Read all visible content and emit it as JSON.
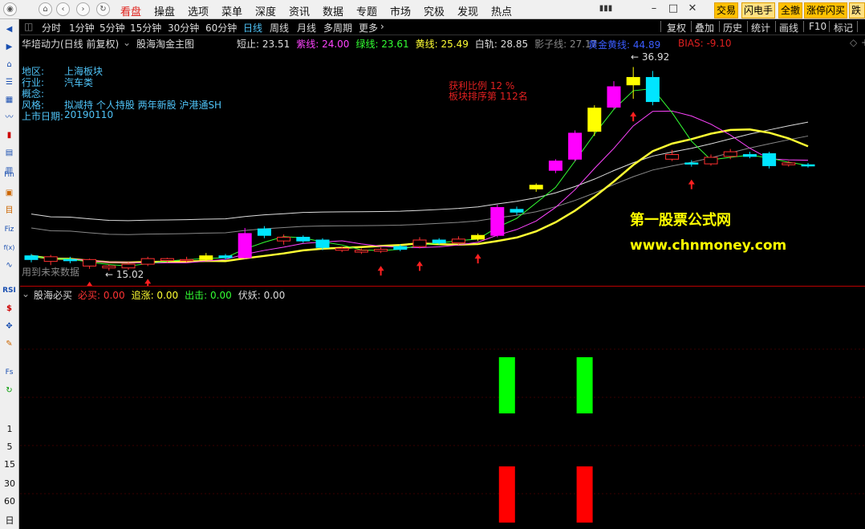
{
  "menubar": {
    "items": [
      "看盘",
      "操盘",
      "选项",
      "菜单",
      "深度",
      "资讯",
      "数据",
      "专题",
      "市场",
      "究极",
      "发现",
      "热点"
    ],
    "active_index": 0,
    "trade_buttons": [
      "交易",
      "闪电手",
      "全撤",
      "涨停闪买",
      "跌"
    ]
  },
  "lefttool": {
    "icons": [
      "back-arrow-icon",
      "forward-arrow-icon",
      "home-icon",
      "list-icon",
      "grid-icon",
      "line-chart-icon",
      "candle-icon",
      "table-icon",
      "stack-icon",
      "fin-icon",
      "f10-icon",
      "news-icon",
      "formula-icon",
      "fx-icon",
      "wave-icon",
      "rsi-icon",
      "dollar-icon",
      "move-icon",
      "pencil-icon",
      "fs-icon",
      "refresh-icon"
    ],
    "labels": {
      "fin": "Fin",
      "fiz": "Fiz",
      "fx": "f(x)",
      "rsi": "RSI",
      "fs": "Fs"
    },
    "numbers": [
      "1",
      "5",
      "15",
      "30",
      "60",
      "日"
    ]
  },
  "charttool": {
    "periods": [
      "分时",
      "1分钟",
      "5分钟",
      "15分钟",
      "30分钟",
      "60分钟",
      "日线",
      "周线",
      "月线",
      "多周期",
      "更多"
    ],
    "active_period": 6,
    "right_buttons": [
      "复权",
      "叠加",
      "历史",
      "统计",
      "画线",
      "F10",
      "标记"
    ]
  },
  "info": {
    "stock_name": "华培动力(日线 前复权)",
    "indicator": "股海淘金主图",
    "values": [
      {
        "label": "短止",
        "value": "23.51",
        "color": "#dddddd"
      },
      {
        "label": "紫线",
        "value": "24.00",
        "color": "#ff44ff"
      },
      {
        "label": "绿线",
        "value": "23.61",
        "color": "#33ff33"
      },
      {
        "label": "黄线",
        "value": "25.49",
        "color": "#ffff33"
      },
      {
        "label": "白轨",
        "value": "28.85",
        "color": "#dddddd"
      },
      {
        "label": "影子线",
        "value": "27.17",
        "color": "#888888"
      }
    ]
  },
  "overlay": {
    "region_label": "地区:",
    "region_value": "上海板块",
    "industry_label": "行业:",
    "industry_value": "汽车类",
    "concept_label": "概念:",
    "style_label": "风格:",
    "style_value": "拟减持 个人持股 两年新股 沪港通SH",
    "listing_label": "上市日期:",
    "listing_value": "20190110",
    "profit_ratio": "获利比例 12 %",
    "sector_rank": "板块排序第 112名",
    "golden_line": "黄金黄线: 44.89",
    "bias": "BIAS: -9.10",
    "high_price": "36.92",
    "low_price": "15.02",
    "future_data": "用到未来数据",
    "watermark_title": "第一股票公式网",
    "watermark_url": "www.chnmoney.com"
  },
  "sub": {
    "indicator": "股海必买",
    "values": [
      {
        "label": "必买",
        "value": "0.00",
        "color": "#ff3333"
      },
      {
        "label": "追涨",
        "value": "0.00",
        "color": "#ffff33"
      },
      {
        "label": "出击",
        "value": "0.00",
        "color": "#33ff33"
      },
      {
        "label": "伏妖",
        "value": "0.00",
        "color": "#dddddd"
      }
    ]
  },
  "chart_data": {
    "type": "candlestick",
    "candles": [
      {
        "o": 16.2,
        "c": 16.6,
        "h": 16.8,
        "l": 15.9,
        "col": "cyan"
      },
      {
        "o": 16.5,
        "c": 16.0,
        "h": 16.7,
        "l": 15.6,
        "col": "red"
      },
      {
        "o": 16.1,
        "c": 16.2,
        "h": 16.5,
        "l": 15.8,
        "col": "cyan"
      },
      {
        "o": 16.2,
        "c": 15.5,
        "h": 16.3,
        "l": 15.2,
        "col": "red"
      },
      {
        "o": 15.5,
        "c": 15.3,
        "h": 15.7,
        "l": 15.02,
        "col": "red"
      },
      {
        "o": 15.3,
        "c": 15.7,
        "h": 15.9,
        "l": 15.1,
        "col": "red"
      },
      {
        "o": 15.7,
        "c": 16.3,
        "h": 16.5,
        "l": 15.5,
        "col": "red"
      },
      {
        "o": 16.3,
        "c": 16.1,
        "h": 16.4,
        "l": 15.9,
        "col": "red"
      },
      {
        "o": 16.1,
        "c": 16.2,
        "h": 16.5,
        "l": 15.9,
        "col": "red"
      },
      {
        "o": 16.2,
        "c": 16.6,
        "h": 16.9,
        "l": 16.0,
        "col": "yellow"
      },
      {
        "o": 16.6,
        "c": 16.4,
        "h": 16.8,
        "l": 16.2,
        "col": "cyan"
      },
      {
        "o": 16.4,
        "c": 19.0,
        "h": 19.6,
        "l": 16.3,
        "col": "magenta"
      },
      {
        "o": 19.5,
        "c": 18.8,
        "h": 19.8,
        "l": 18.5,
        "col": "cyan"
      },
      {
        "o": 18.6,
        "c": 18.2,
        "h": 18.9,
        "l": 17.8,
        "col": "red"
      },
      {
        "o": 18.2,
        "c": 18.6,
        "h": 18.8,
        "l": 18.0,
        "col": "cyan"
      },
      {
        "o": 18.3,
        "c": 17.5,
        "h": 18.5,
        "l": 17.2,
        "col": "cyan"
      },
      {
        "o": 17.4,
        "c": 17.2,
        "h": 17.6,
        "l": 17.0,
        "col": "red"
      },
      {
        "o": 17.2,
        "c": 17.0,
        "h": 17.4,
        "l": 16.8,
        "col": "red"
      },
      {
        "o": 17.1,
        "c": 17.3,
        "h": 17.5,
        "l": 16.9,
        "col": "red"
      },
      {
        "o": 17.3,
        "c": 17.6,
        "h": 17.8,
        "l": 17.1,
        "col": "cyan"
      },
      {
        "o": 17.6,
        "c": 18.3,
        "h": 18.6,
        "l": 17.4,
        "col": "red"
      },
      {
        "o": 18.3,
        "c": 18.0,
        "h": 18.5,
        "l": 17.8,
        "col": "cyan"
      },
      {
        "o": 18.0,
        "c": 18.4,
        "h": 18.7,
        "l": 17.8,
        "col": "red"
      },
      {
        "o": 18.4,
        "c": 18.8,
        "h": 19.0,
        "l": 18.2,
        "col": "yellow"
      },
      {
        "o": 18.8,
        "c": 21.8,
        "h": 22.1,
        "l": 18.6,
        "col": "magenta"
      },
      {
        "o": 21.6,
        "c": 21.3,
        "h": 21.9,
        "l": 21.0,
        "col": "cyan"
      },
      {
        "o": 24.2,
        "c": 23.8,
        "h": 24.4,
        "l": 23.5,
        "col": "yellow"
      },
      {
        "o": 25.8,
        "c": 26.8,
        "h": 27.0,
        "l": 25.5,
        "col": "magenta"
      },
      {
        "o": 27.0,
        "c": 29.8,
        "h": 30.1,
        "l": 26.8,
        "col": "magenta"
      },
      {
        "o": 30.0,
        "c": 32.5,
        "h": 32.8,
        "l": 29.5,
        "col": "yellow"
      },
      {
        "o": 32.6,
        "c": 34.8,
        "h": 35.4,
        "l": 32.4,
        "col": "magenta"
      },
      {
        "o": 35.0,
        "c": 35.8,
        "h": 36.92,
        "l": 33.5,
        "col": "yellow"
      },
      {
        "o": 35.8,
        "c": 33.2,
        "h": 36.5,
        "l": 32.8,
        "col": "cyan"
      },
      {
        "o": 27.5,
        "c": 27.0,
        "h": 28.0,
        "l": 26.8,
        "col": "red"
      },
      {
        "o": 26.6,
        "c": 26.6,
        "h": 26.9,
        "l": 26.2,
        "col": "cyan"
      },
      {
        "o": 26.5,
        "c": 27.2,
        "h": 27.5,
        "l": 26.3,
        "col": "red"
      },
      {
        "o": 27.3,
        "c": 27.8,
        "h": 28.1,
        "l": 27.0,
        "col": "red"
      },
      {
        "o": 27.5,
        "c": 27.3,
        "h": 27.8,
        "l": 27.1,
        "col": "cyan"
      },
      {
        "o": 27.6,
        "c": 26.3,
        "h": 27.8,
        "l": 26.0,
        "col": "cyan"
      },
      {
        "o": 26.6,
        "c": 26.4,
        "h": 26.8,
        "l": 26.2,
        "col": "red"
      },
      {
        "o": 26.4,
        "c": 26.3,
        "h": 26.6,
        "l": 26.1,
        "col": "cyan"
      }
    ],
    "sub_bars": [
      {
        "index": 24,
        "green": 1,
        "red": 1
      },
      {
        "index": 28,
        "green": 1,
        "red": 1
      }
    ],
    "ylim": [
      14.5,
      38
    ]
  }
}
